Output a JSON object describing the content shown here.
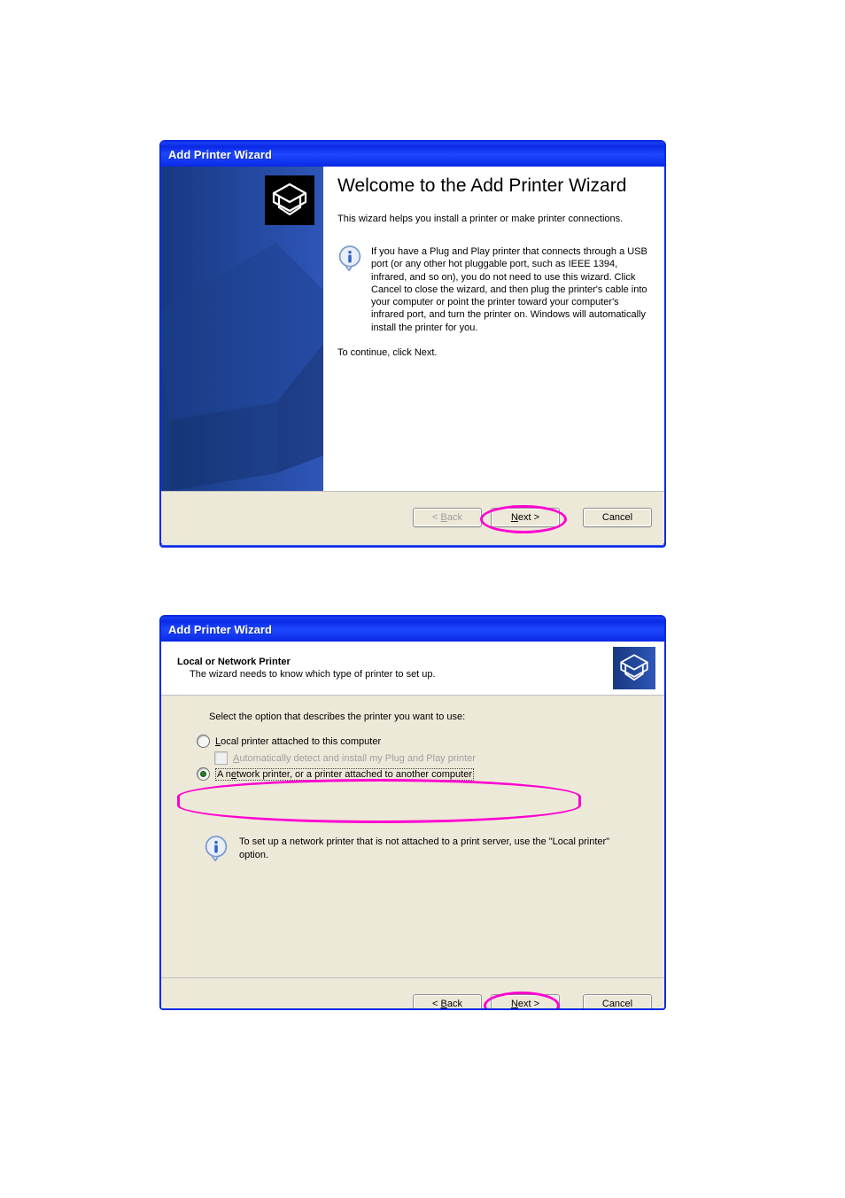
{
  "wizard1": {
    "title": "Add Printer Wizard",
    "heading": "Welcome to the Add Printer Wizard",
    "intro": "This wizard helps you install a printer or make printer connections.",
    "info": "If you have a Plug and Play printer that connects through a USB port (or any other hot pluggable port, such as IEEE 1394, infrared, and so on), you do not need to use this wizard. Click Cancel to close the wizard, and then plug the printer's cable into your computer or point the printer toward your computer's infrared port, and turn the printer on. Windows will automatically install the printer for you.",
    "continue": "To continue, click Next.",
    "back_label": "< Back",
    "next_label": "Next >",
    "cancel_label": "Cancel"
  },
  "wizard2": {
    "title": "Add Printer Wizard",
    "heading": "Local or Network Printer",
    "subheading": "The wizard needs to know which type of printer to set up.",
    "prompt": "Select the option that describes the printer you want to use:",
    "option_local": "Local printer attached to this computer",
    "option_autodetect": "Automatically detect and install my Plug and Play printer",
    "option_network": "A network printer, or a printer attached to another computer",
    "info": "To set up a network printer that is not attached to a print server, use the \"Local printer\" option.",
    "back_label": "< Back",
    "next_label": "Next >",
    "cancel_label": "Cancel"
  }
}
